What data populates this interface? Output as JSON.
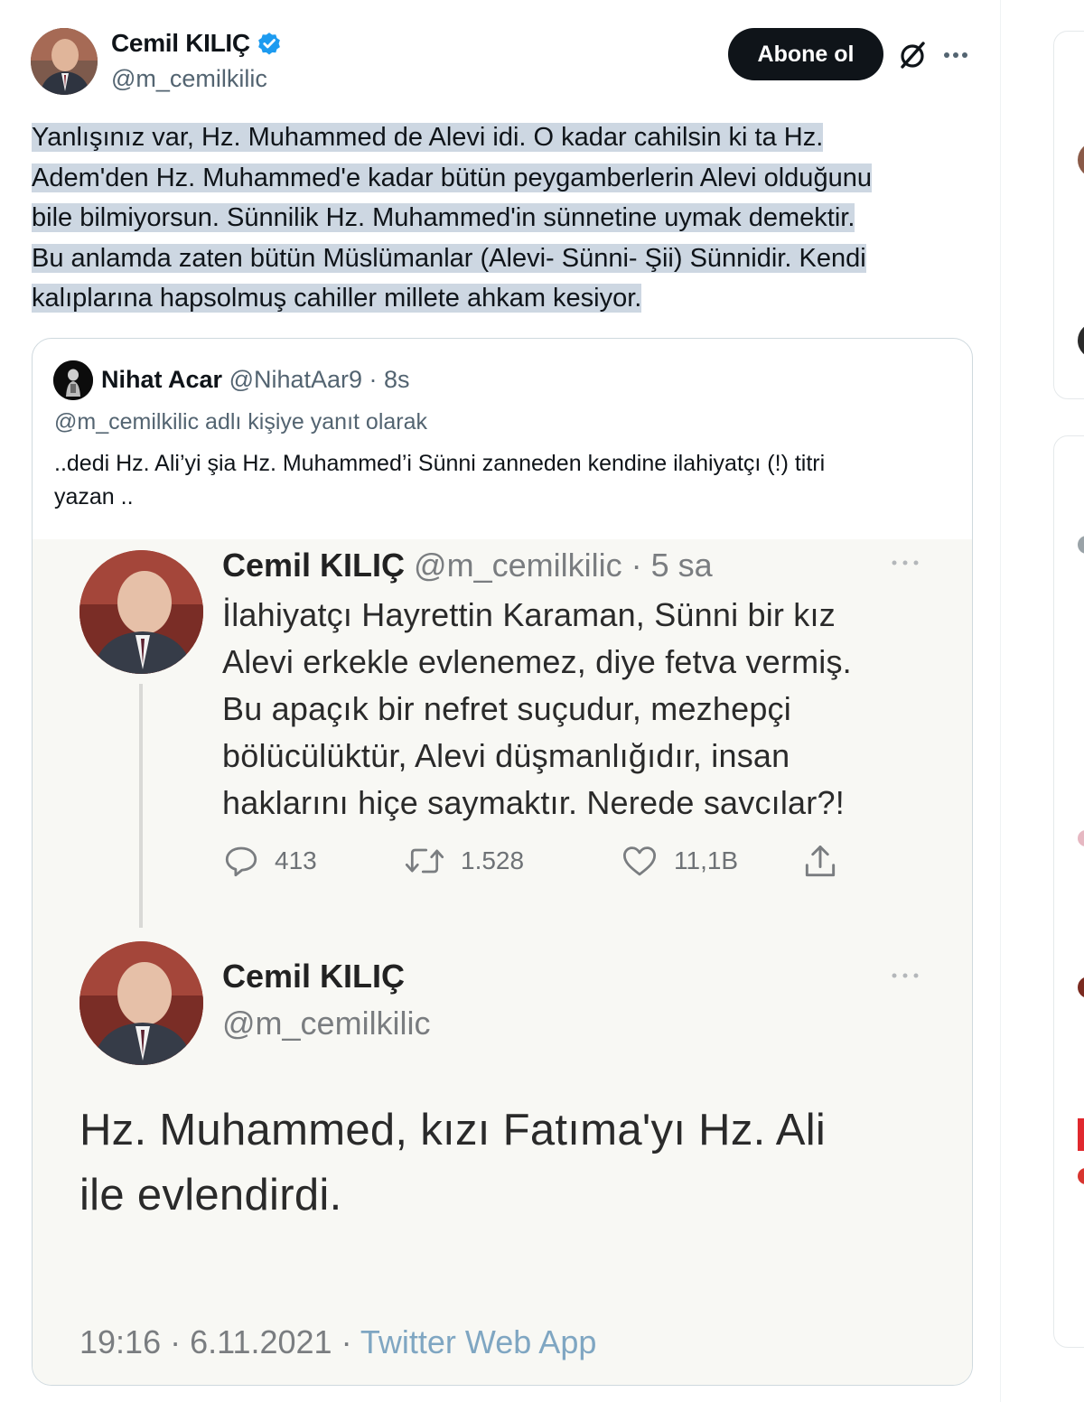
{
  "tweet": {
    "author_name": "Cemil KILIÇ",
    "author_handle": "@m_cemilkilic",
    "verified": true,
    "follow_label": "Abone ol",
    "text_lines": [
      "Yanlışınız var, Hz. Muhammed de Alevi idi. O kadar cahilsin ki ta Hz.",
      "Adem'den Hz. Muhammed'e kadar bütün peygamberlerin Alevi olduğunu",
      "bile bilmiyorsun. Sünnilik Hz. Muhammed'in sünnetine uymak demektir.",
      "Bu anlamda zaten bütün Müslümanlar (Alevi- Sünni- Şii) Sünnidir. Kendi",
      "kalıplarına hapsolmuş cahiller millete ahkam kesiyor."
    ]
  },
  "quote": {
    "author_name": "Nihat Acar",
    "author_meta": "@NihatAar9 · 8s",
    "reply_to": "@m_cemilkilic adlı kişiye yanıt olarak",
    "text_lines": [
      "..dedi Hz. Ali’yi şia Hz. Muhammed’i Sünni zanneden kendine ilahiyatçı (!) titri",
      "yazan .."
    ]
  },
  "embedded": {
    "first": {
      "name": "Cemil KILIÇ",
      "meta": "@m_cemilkilic · 5 sa",
      "text_lines": [
        "İlahiyatçı Hayrettin Karaman, Sünni bir kız",
        "Alevi erkekle evlenemez, diye fetva vermiş.",
        "Bu apaçık bir nefret suçudur, mezhepçi",
        "bölücülüktür, Alevi düşmanlığıdır, insan",
        "haklarını hiçe saymaktır. Nerede savcılar?!"
      ],
      "replies": "413",
      "retweets": "1.528",
      "likes": "11,1B"
    },
    "second": {
      "name": "Cemil KILIÇ",
      "handle": "@m_cemilkilic",
      "text_lines": [
        "Hz. Muhammed, kızı Fatıma'yı Hz. Ali",
        "ile evlendirdi."
      ],
      "time": "19:16 · 6.11.2021 · ",
      "source": "Twitter Web App"
    }
  },
  "colors": {
    "text": "#0f1419",
    "secondary": "#536471",
    "highlight": "#cdd7e2",
    "verified": "#1d9bf0",
    "source_link": "#7fa6c2"
  },
  "icons": [
    "verified-badge-icon",
    "grok-icon",
    "more-icon",
    "reply-icon",
    "retweet-icon",
    "like-icon",
    "share-icon"
  ]
}
